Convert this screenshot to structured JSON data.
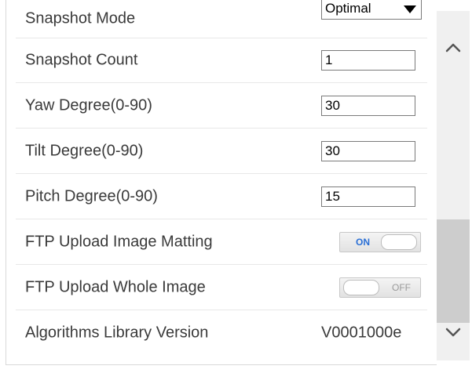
{
  "settings": {
    "snapshot_mode": {
      "label": "Snapshot Mode",
      "value": "Optimal"
    },
    "snapshot_count": {
      "label": "Snapshot Count",
      "value": "1"
    },
    "yaw_degree": {
      "label": "Yaw Degree(0-90)",
      "value": "30"
    },
    "tilt_degree": {
      "label": "Tilt Degree(0-90)",
      "value": "30"
    },
    "pitch_degree": {
      "label": "Pitch Degree(0-90)",
      "value": "15"
    },
    "ftp_image_matting": {
      "label": "FTP Upload Image Matting",
      "state": "ON"
    },
    "ftp_whole_image": {
      "label": "FTP Upload Whole Image",
      "state": "OFF"
    },
    "algorithms_version": {
      "label": "Algorithms Library Version",
      "value": "V0001000e"
    }
  },
  "icons": {
    "select_arrow": "triangle-down",
    "scroll_up": "chevron-up",
    "scroll_down": "chevron-down"
  },
  "colors": {
    "toggle_on_text": "#2a6fd6",
    "toggle_off_text": "#9a9a9a",
    "scroll_thumb": "#cdcdcd",
    "scroll_track": "#f0f0f0"
  }
}
